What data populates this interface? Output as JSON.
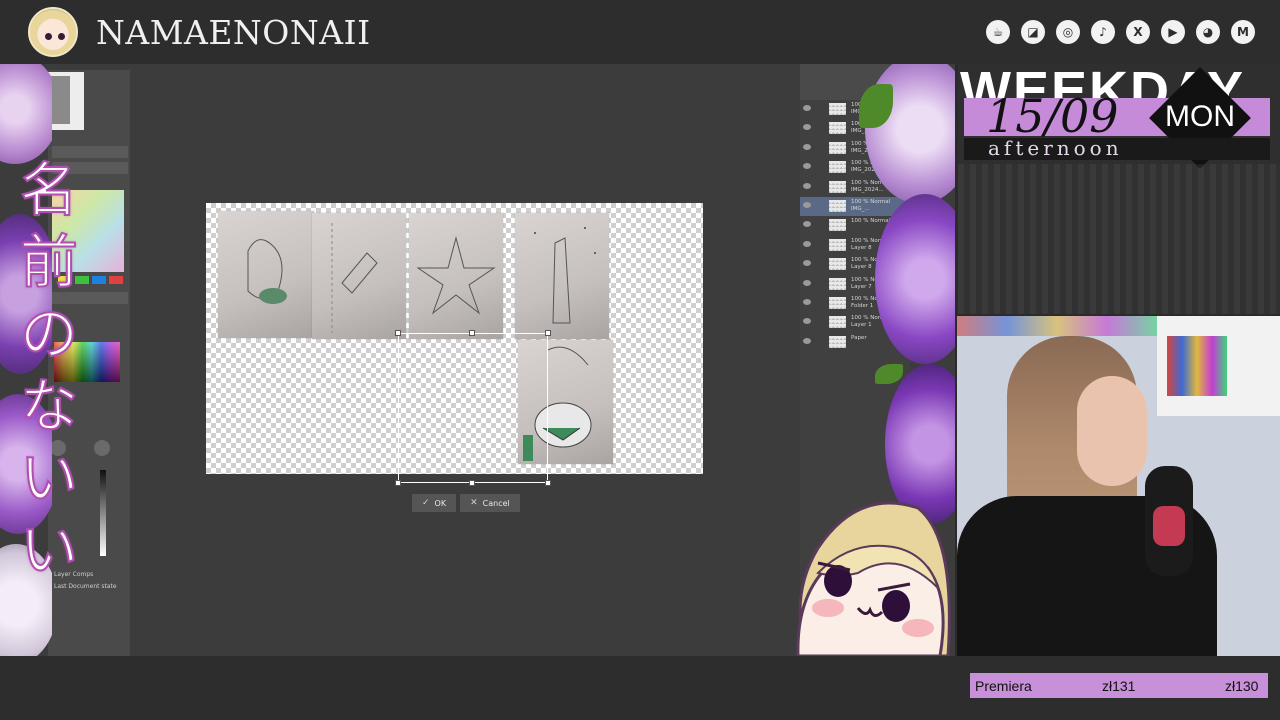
{
  "channel": {
    "name": "NAMAENONAII"
  },
  "social_icons": [
    "kofi-icon",
    "twitch-icon",
    "instagram-icon",
    "tiktok-icon",
    "x-icon",
    "youtube-icon",
    "discord-icon",
    "gmail-icon"
  ],
  "social_glyphs": [
    "☕",
    "◪",
    "◎",
    "♪",
    "X",
    "▶",
    "◕",
    "M"
  ],
  "vertical_title": [
    "名",
    "前",
    "の",
    "な",
    "い",
    "い"
  ],
  "canvas": {
    "ok_label": "OK",
    "cancel_label": "Cancel"
  },
  "left_panel": {
    "layer_comps_title": "Layer Comps",
    "layer_comps_state": "Last Document state"
  },
  "layers": [
    {
      "name": "100 % Normal IMG_2024..."
    },
    {
      "name": "100 % Normal IMG_2024..."
    },
    {
      "name": "100 % Normal IMG_202412..."
    },
    {
      "name": "100 % Normal IMG_2024..."
    },
    {
      "name": "100 % Normal IMG_2024..."
    },
    {
      "name": "100 % Normal IMG_..."
    },
    {
      "name": "100 % Normal"
    },
    {
      "name": "100 % Normal Layer 8"
    },
    {
      "name": "100 % Normal Layer 8"
    },
    {
      "name": "100 % Normal Layer 7"
    },
    {
      "name": "100 % Normal Folder 1"
    },
    {
      "name": "100 % Normal Layer 1"
    },
    {
      "name": "Paper"
    }
  ],
  "schedule": {
    "heading": "WEEKDAY",
    "date": "15/09",
    "day": "MON",
    "time_of_day": "afternoon"
  },
  "ticker": {
    "label": "Premiera",
    "value_1": "zł131",
    "value_2": "zł130"
  },
  "colors": {
    "accent_lilac": "#c790d8",
    "title_stroke": "#b14fb1",
    "bar_background": "#2d2d2d"
  }
}
